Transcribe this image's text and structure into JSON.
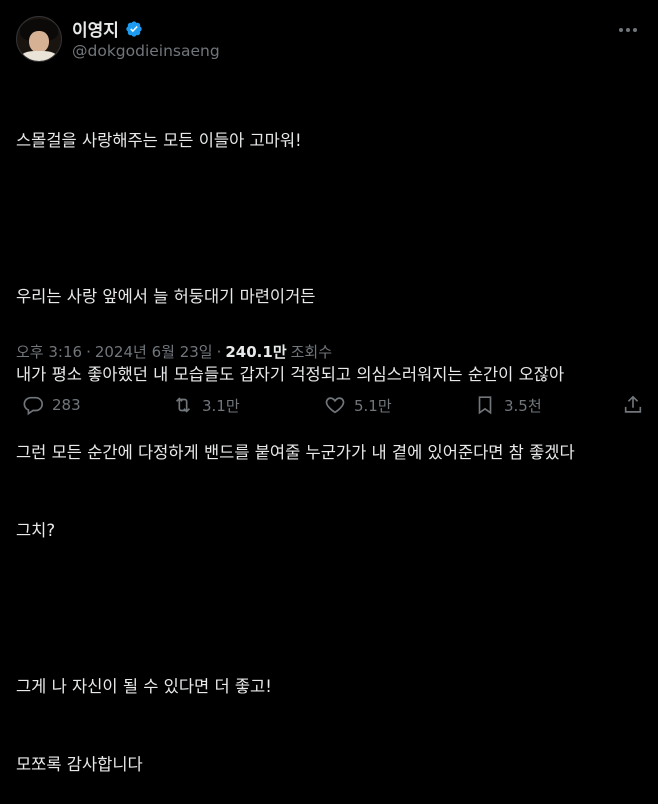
{
  "author": {
    "display_name": "이영지",
    "handle": "@dokgodieinsaeng",
    "verified": true
  },
  "tweet": {
    "paragraphs": [
      [
        "스몰걸을 사랑해주는 모든 이들아 고마워!"
      ],
      [
        "우리는 사랑 앞에서 늘 허둥대기 마련이거든",
        "내가 평소 좋아했던 내 모습들도 갑자기 걱정되고 의심스러워지는 순간이 오잖아",
        "그런 모든 순간에 다정하게 밴드를 붙여줄 누군가가 내 곁에 있어준다면 참 좋겠다",
        "그치?"
      ],
      [
        "그게 나 자신이 될 수 있다면 더 좋고!",
        "모쪼록 감사합니다"
      ]
    ]
  },
  "meta": {
    "time": "오후 3:16",
    "separator": "·",
    "date": "2024년 6월 23일",
    "views_count": "240.1만",
    "views_label": "조회수"
  },
  "actions": {
    "replies": "283",
    "reposts": "3.1만",
    "likes": "5.1만",
    "bookmarks": "3.5천"
  },
  "colors": {
    "background": "#000000",
    "text": "#e7e9ea",
    "secondary": "#71767b",
    "verified": "#1d9bf0"
  }
}
